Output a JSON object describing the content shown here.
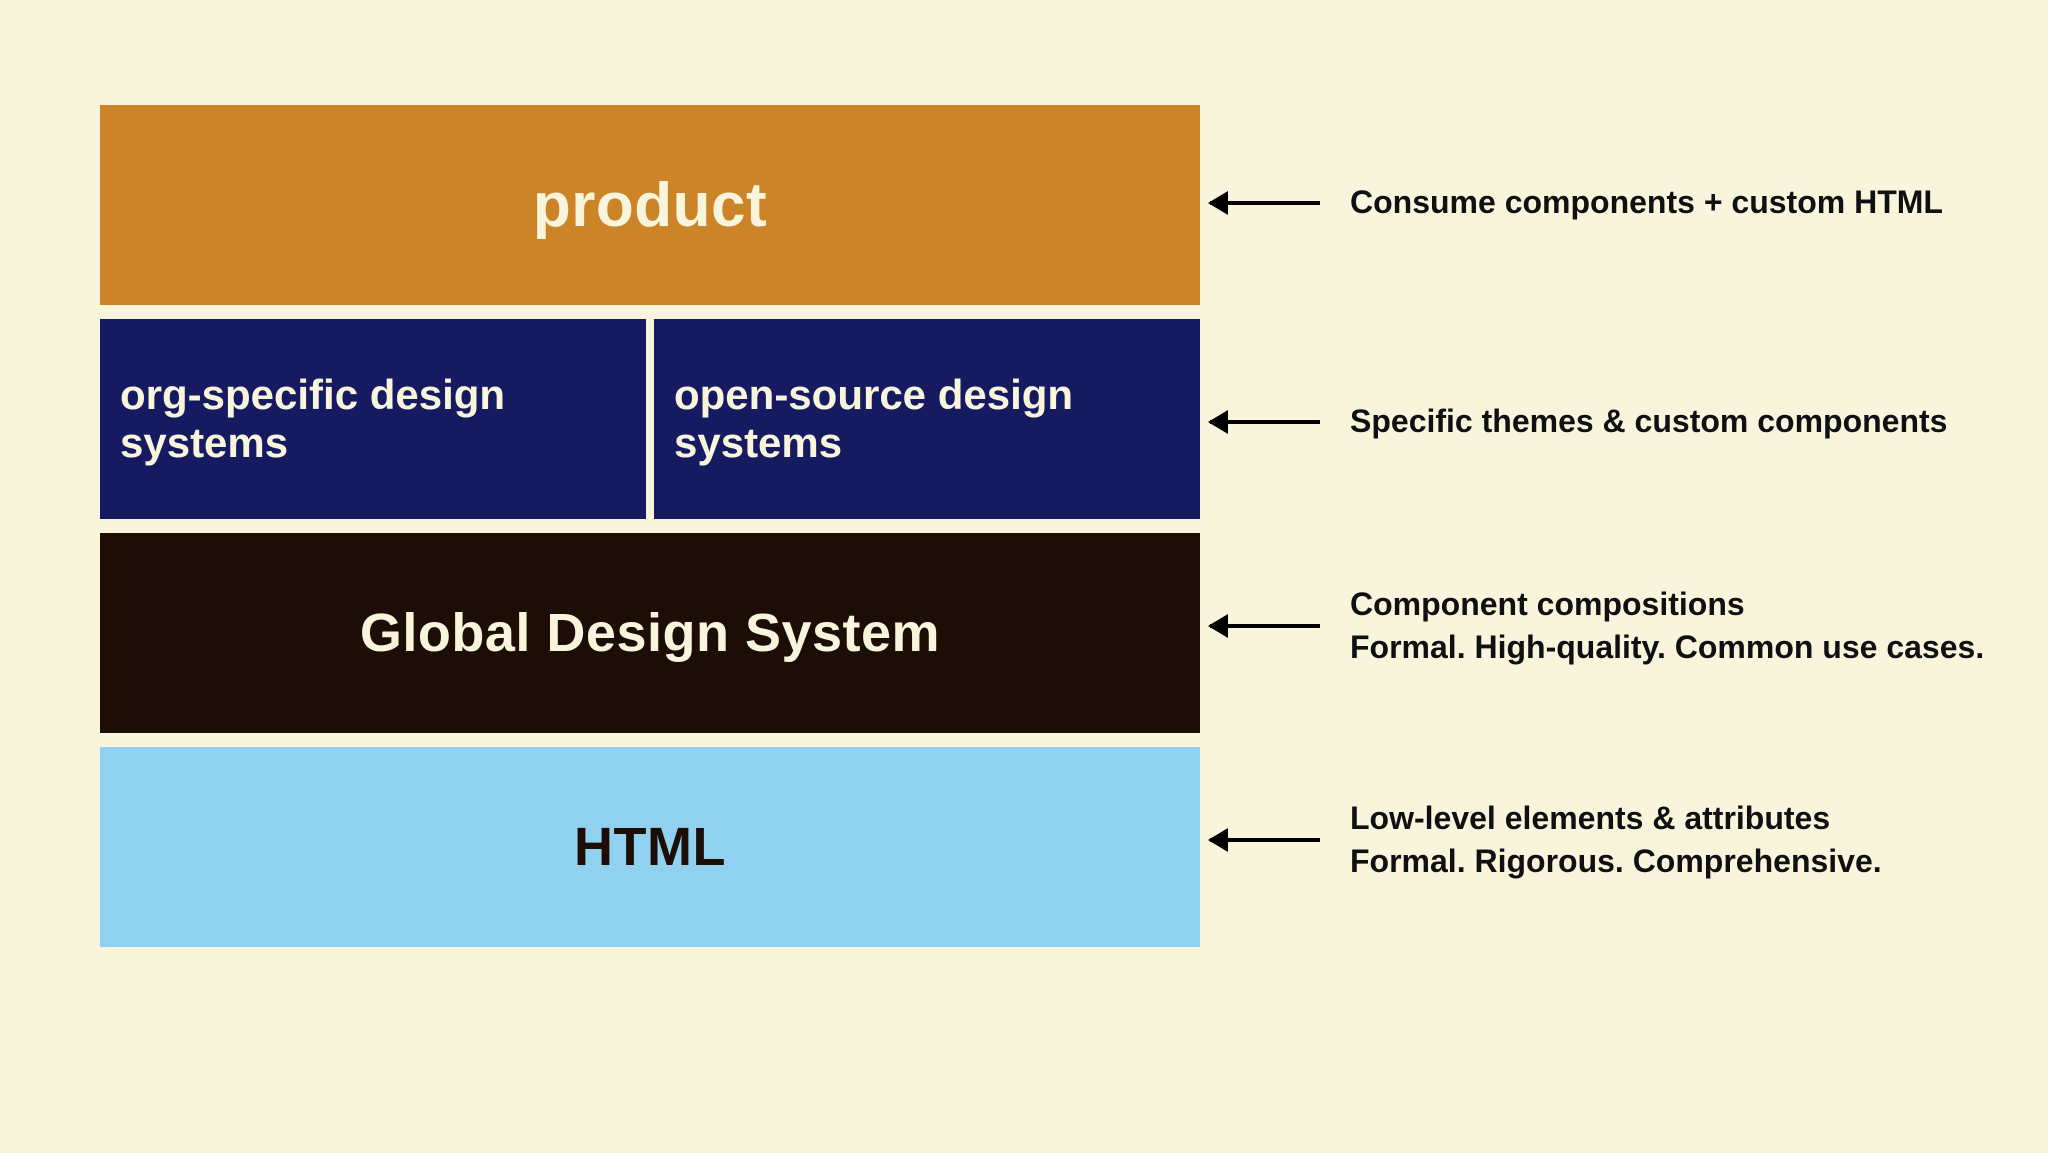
{
  "layers": {
    "product": "product",
    "org_specific": "org-specific design systems",
    "open_source": "open-source design systems",
    "global": "Global Design System",
    "html": "HTML"
  },
  "annotations": {
    "product": "Consume components + custom HTML",
    "design_systems": "Specific themes & custom components",
    "global_line1": "Component compositions",
    "global_line2": "Formal. High-quality. Common use cases.",
    "html_line1": "Low-level elements & attributes",
    "html_line2": "Formal. Rigorous. Comprehensive."
  },
  "colors": {
    "background": "#f9f5dc",
    "product": "#cb8427",
    "design_systems": "#161b61",
    "global": "#1c0e07",
    "html": "#8fd1ef",
    "text_dark": "#0f1012"
  }
}
